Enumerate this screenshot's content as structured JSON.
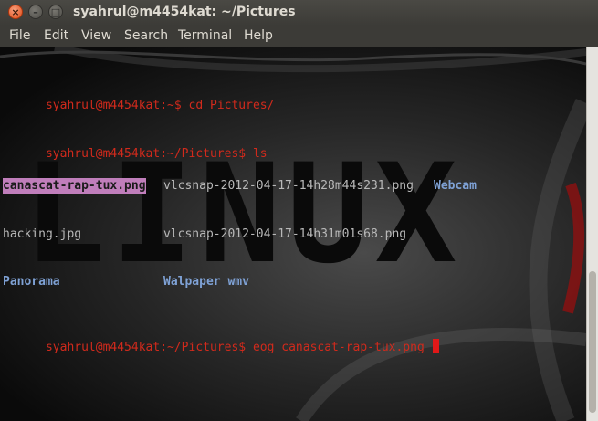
{
  "window": {
    "title": "syahrul@m4454kat: ~/Pictures",
    "close_glyph": "×",
    "min_glyph": "–",
    "max_glyph": "□"
  },
  "menu": [
    "File",
    "Edit",
    "View",
    "Search",
    "Terminal",
    "Help"
  ],
  "terminal": {
    "background_word": "LINUX",
    "line1": {
      "prompt": "syahrul@m4454kat:~$",
      "command": " cd Pictures/"
    },
    "line2": {
      "prompt": "syahrul@m4454kat:~/Pictures$",
      "command": " ls"
    },
    "ls_row1": [
      "canascat-rap-tux.png",
      "vlcsnap-2012-04-17-14h28m44s231.png",
      "Webcam"
    ],
    "ls_row2": [
      "hacking.jpg",
      "vlcsnap-2012-04-17-14h31m01s68.png"
    ],
    "ls_row3": [
      "Panorama",
      "Walpaper wmv"
    ],
    "line6": {
      "prompt": "syahrul@m4454kat:~/Pictures$",
      "command": " eog canascat-rap-tux.png "
    }
  },
  "colors": {
    "prompt": "#d12a1c",
    "directory": "#7fa2d6",
    "highlight": "#c07ebb",
    "close_button": "#df4a16"
  }
}
